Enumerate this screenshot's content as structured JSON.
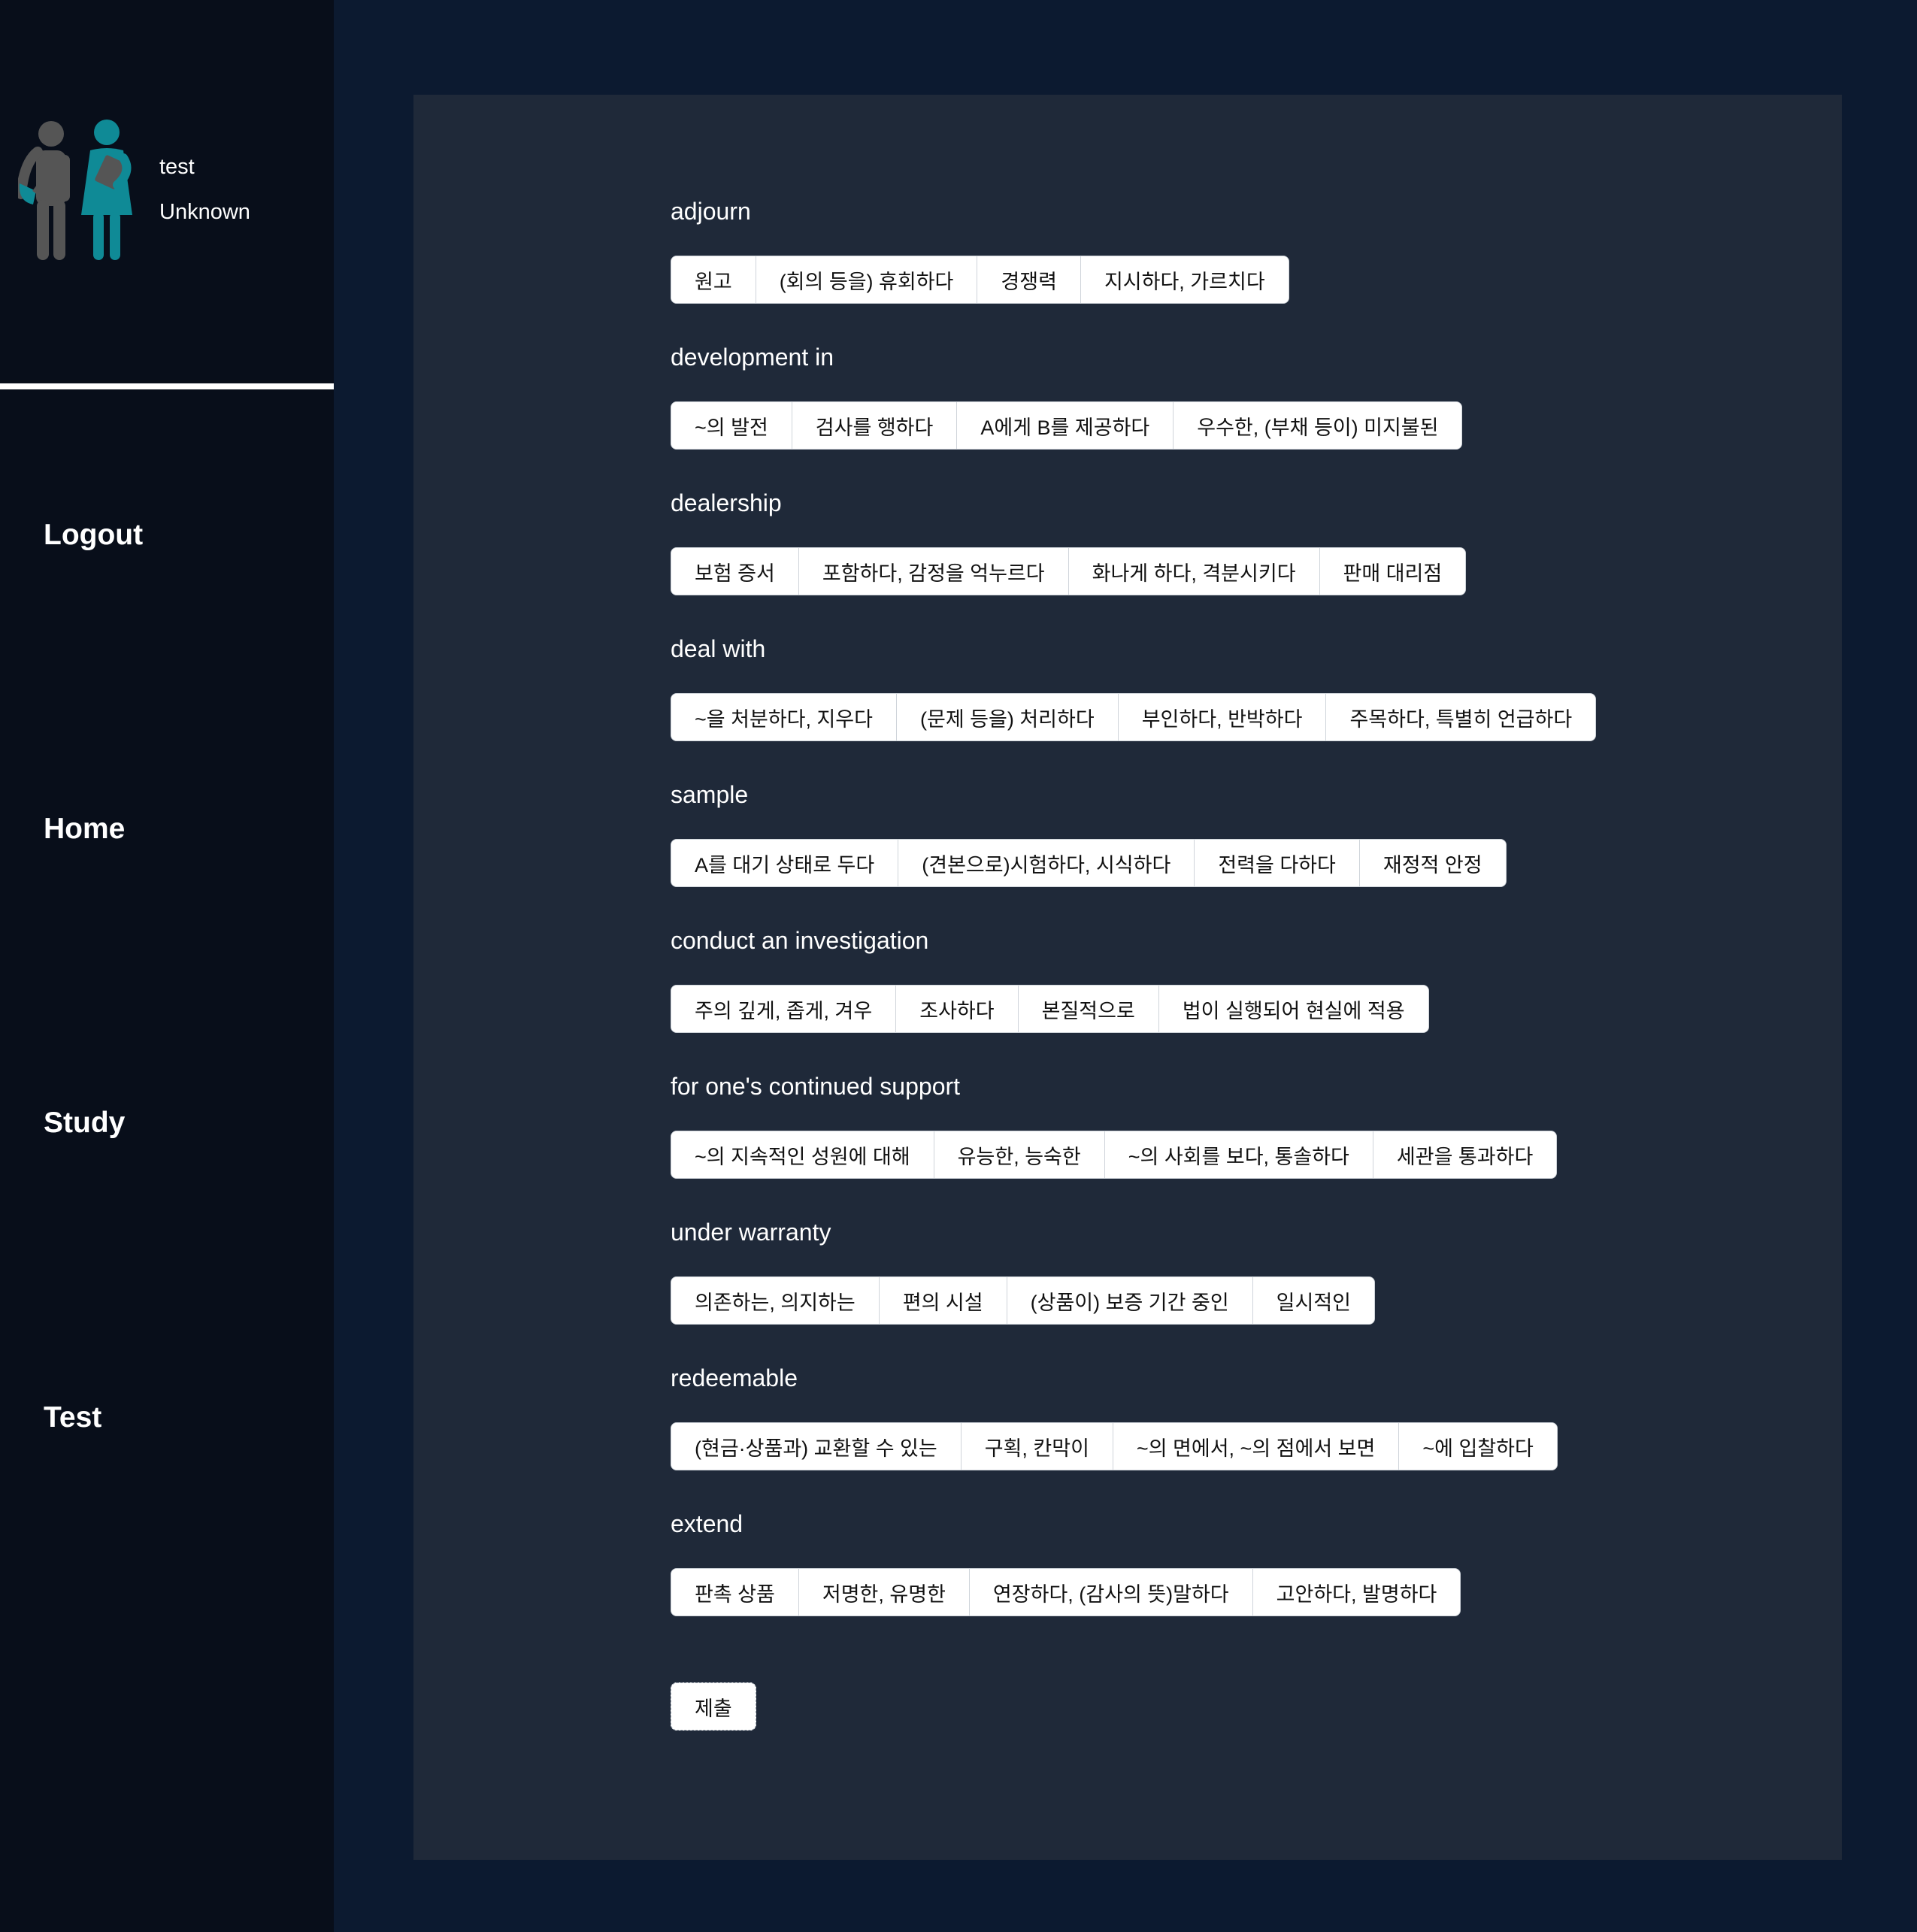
{
  "user": {
    "name": "test",
    "status": "Unknown"
  },
  "nav": {
    "logout": "Logout",
    "home": "Home",
    "study": "Study",
    "test": "Test"
  },
  "questions": [
    {
      "word": "adjourn",
      "options": [
        "원고",
        "(회의 등을) 휴회하다",
        "경쟁력",
        "지시하다, 가르치다"
      ]
    },
    {
      "word": "development in",
      "options": [
        "~의 발전",
        "검사를 행하다",
        "A에게 B를 제공하다",
        "우수한, (부채 등이) 미지불된"
      ]
    },
    {
      "word": "dealership",
      "options": [
        "보험 증서",
        "포함하다, 감정을 억누르다",
        "화나게 하다, 격분시키다",
        "판매 대리점"
      ]
    },
    {
      "word": "deal with",
      "options": [
        "~을 처분하다, 지우다",
        "(문제 등을) 처리하다",
        "부인하다, 반박하다",
        "주목하다, 특별히 언급하다"
      ]
    },
    {
      "word": "sample",
      "options": [
        "A를 대기 상태로 두다",
        "(견본으로)시험하다, 시식하다",
        "전력을 다하다",
        "재정적 안정"
      ]
    },
    {
      "word": "conduct an investigation",
      "options": [
        "주의 깊게, 좁게, 겨우",
        "조사하다",
        "본질적으로",
        "법이 실행되어 현실에 적용"
      ]
    },
    {
      "word": "for one's continued support",
      "options": [
        "~의 지속적인 성원에 대해",
        "유능한, 능숙한",
        "~의 사회를 보다, 통솔하다",
        "세관을 통과하다"
      ]
    },
    {
      "word": "under warranty",
      "options": [
        "의존하는, 의지하는",
        "편의 시설",
        "(상품이) 보증 기간 중인",
        "일시적인"
      ]
    },
    {
      "word": "redeemable",
      "options": [
        "(현금·상품과) 교환할 수 있는",
        "구획, 칸막이",
        "~의 면에서, ~의 점에서 보면",
        "~에 입찰하다"
      ]
    },
    {
      "word": "extend",
      "options": [
        "판촉 상품",
        "저명한, 유명한",
        "연장하다, (감사의 뜻)말하다",
        "고안하다, 발명하다"
      ]
    }
  ],
  "submit_label": "제출",
  "colors": {
    "sidebar_bg": "#080e1a",
    "page_bg": "#0c1a30",
    "panel_bg": "#1f2939",
    "avatar_gray": "#555555",
    "avatar_teal": "#0f8a96"
  }
}
